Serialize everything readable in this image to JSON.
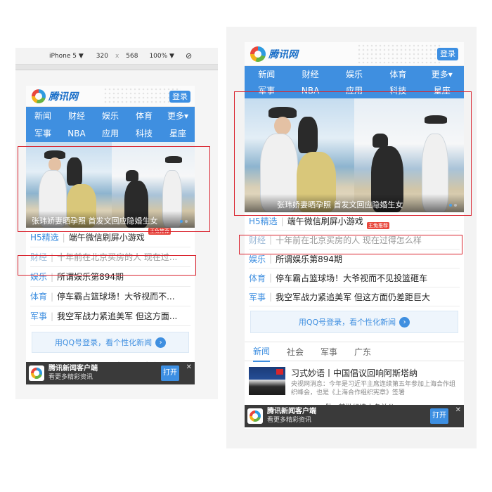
{
  "devtools": {
    "device": "iPhone 5 ▼",
    "width": "320",
    "times": "x",
    "height": "568",
    "zoom": "100% ▼",
    "rotate_icon": "rotate-icon"
  },
  "site": {
    "logo_text": "腾讯网",
    "login": "登录"
  },
  "nav": [
    "新闻",
    "财经",
    "娱乐",
    "体育",
    "更多▾",
    "军事",
    "NBA",
    "应用",
    "科技",
    "星座"
  ],
  "banner": {
    "caption": "张玮娇妻晒孕照 首发文回应隐婚生女"
  },
  "news": [
    {
      "tag": "H5精选",
      "title": "端午微信刷屏小游戏",
      "badge": "王兔推荐"
    },
    {
      "tag": "财经",
      "title": "十年前在北京买房的人 现在过得怎么样",
      "title_short": "十年前在北京买房的人 现在过..."
    },
    {
      "tag": "娱乐",
      "title": "所谓娱乐第894期"
    },
    {
      "tag": "体育",
      "title": "停车霸占篮球场！大爷视而不见投篮砸车",
      "title_short": "停车霸占篮球场！大爷视而不..."
    },
    {
      "tag": "军事",
      "title": "我空军战力紧追美军 但这方面仍差距巨大",
      "title_short": "我空军战力紧追美军 但这方面..."
    }
  ],
  "qq_login": "用QQ号登录，看个性化新闻",
  "tabs": [
    "新闻",
    "社会",
    "军事",
    "广东"
  ],
  "article": {
    "title": "习式妙语丨中国倡议回响阿斯塔纳",
    "summary": "央视网消息：今年是习近平主席连续第五年参加上海合作组织峰会，也是《上海合作组织宪章》签署",
    "behind_text": "“一肋” 首批候选人名单公"
  },
  "app_banner": {
    "name": "腾讯新闻客户端",
    "sub": "看更多精彩资讯",
    "open": "打开",
    "close": "✕"
  },
  "colors": {
    "brand_blue": "#3f8fe0",
    "highlight_red": "#d9232e"
  }
}
